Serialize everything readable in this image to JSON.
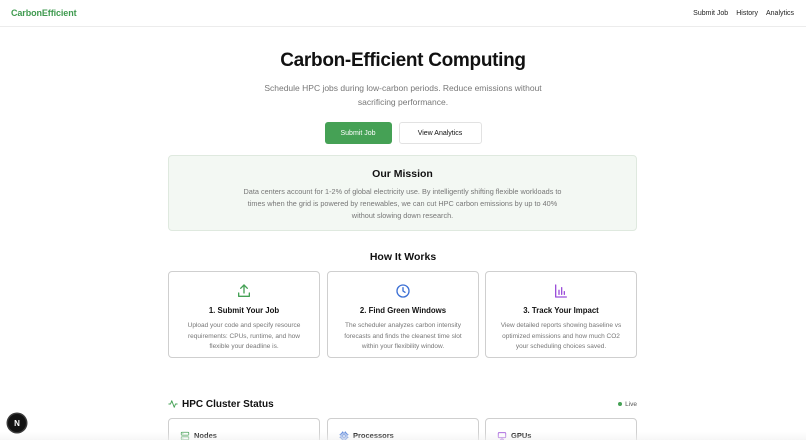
{
  "nav": {
    "brand": "CarbonEfficient",
    "links": [
      "Submit Job",
      "History",
      "Analytics"
    ]
  },
  "hero": {
    "title": "Carbon-Efficient Computing",
    "subtitle": "Schedule HPC jobs during low-carbon periods. Reduce emissions without sacrificing performance.",
    "primary_label": "Submit Job",
    "secondary_label": "View Analytics"
  },
  "mission": {
    "title": "Our Mission",
    "text": "Data centers account for 1-2% of global electricity use. By intelligently shifting flexible workloads to times when the grid is powered by renewables, we can cut HPC carbon emissions by up to 40% without slowing down research."
  },
  "how_it_works": {
    "title": "How It Works",
    "steps": [
      {
        "icon": "upload-icon",
        "title": "1. Submit Your Job",
        "text": "Upload your code and specify resource requirements: CPUs, runtime, and how flexible your deadline is."
      },
      {
        "icon": "clock-icon",
        "title": "2. Find Green Windows",
        "text": "The scheduler analyzes carbon intensity forecasts and finds the cleanest time slot within your flexibility window."
      },
      {
        "icon": "bar-chart-icon",
        "title": "3. Track Your Impact",
        "text": "View detailed reports showing baseline vs optimized emissions and how much CO2 your scheduling choices saved."
      }
    ]
  },
  "cluster": {
    "title": "HPC Cluster Status",
    "live_label": "Live",
    "stats": [
      {
        "icon": "server-icon",
        "label": "Nodes"
      },
      {
        "icon": "cpu-icon",
        "label": "Processors"
      },
      {
        "icon": "monitor-icon",
        "label": "GPUs"
      }
    ]
  },
  "dev_badge": "N",
  "colors": {
    "brand_green": "#3f9a4f",
    "button_green": "#45a155",
    "clock_blue": "#3b6fd4",
    "chart_purple": "#9b4fd9",
    "muted_text": "#777777"
  }
}
